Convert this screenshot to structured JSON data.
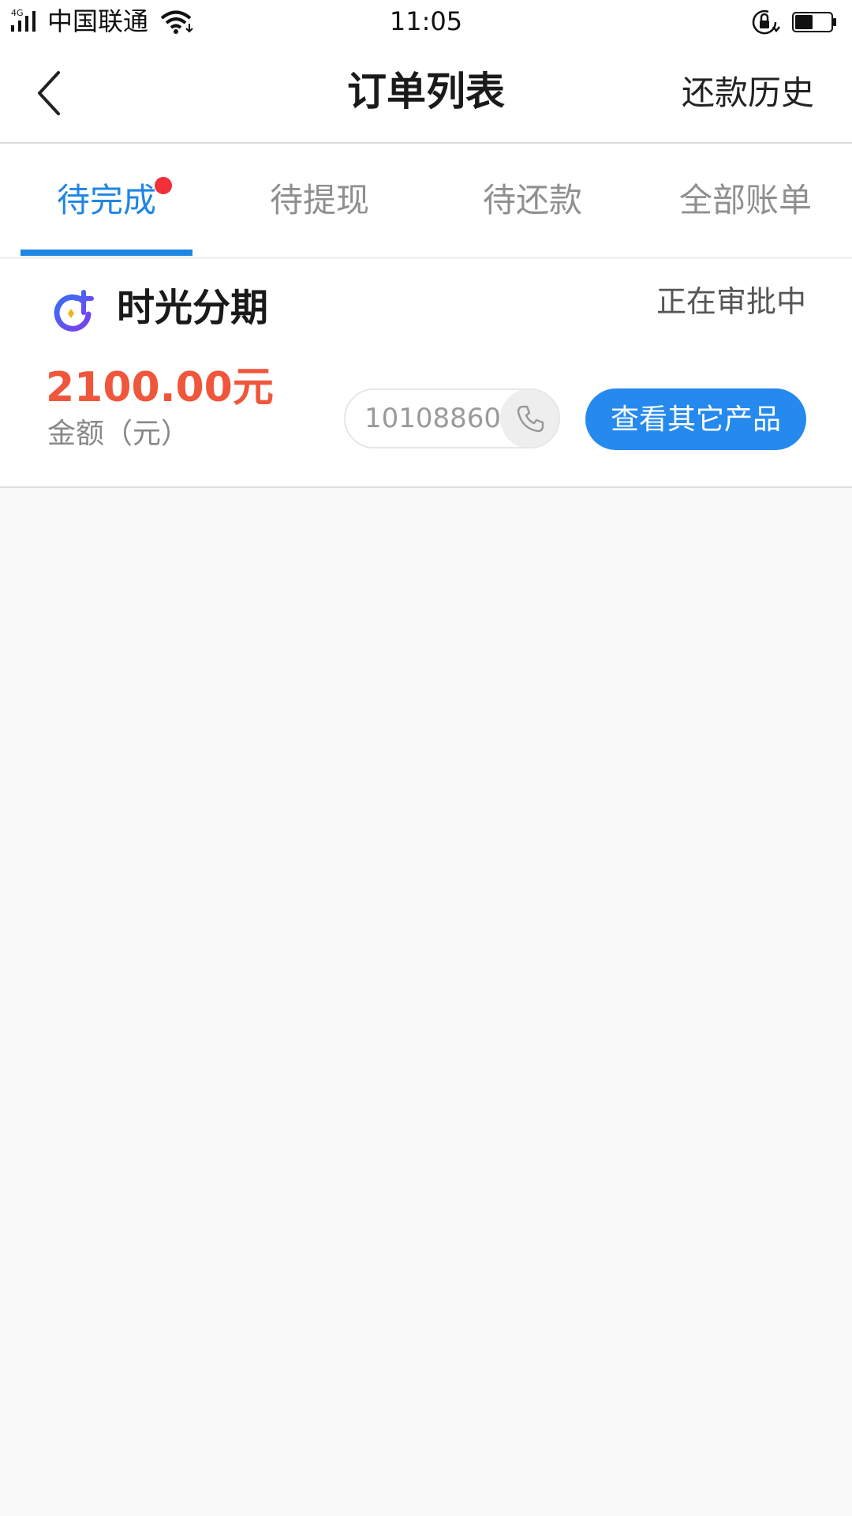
{
  "status_bar": {
    "network": "4G",
    "carrier": "中国联通",
    "time": "11:05",
    "battery_level": 0.5
  },
  "nav": {
    "title": "订单列表",
    "right_action": "还款历史",
    "back_icon": "chevron-left-icon"
  },
  "tabs": [
    {
      "label": "待完成",
      "active": true,
      "badge": true
    },
    {
      "label": "待提现",
      "active": false,
      "badge": false
    },
    {
      "label": "待还款",
      "active": false,
      "badge": false
    },
    {
      "label": "全部账单",
      "active": false,
      "badge": false
    }
  ],
  "order": {
    "product_name": "时光分期",
    "status": "正在审批中",
    "amount": "2100.00元",
    "amount_label": "金额（元）",
    "phone": "10108860",
    "action_label": "查看其它产品"
  },
  "colors": {
    "accent": "#1f86e4",
    "button": "#2589ee",
    "amount": "#f0563b",
    "badge": "#f0303a",
    "background": "#f9f9f9"
  }
}
